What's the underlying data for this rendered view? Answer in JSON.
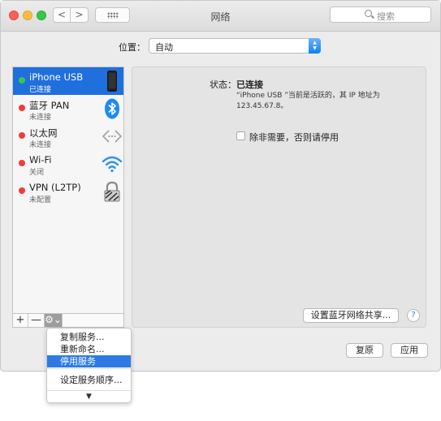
{
  "window": {
    "title": "网络"
  },
  "toolbar": {
    "back_glyph": "<",
    "forward_glyph": ">",
    "grid_icon": "grid-icon"
  },
  "search": {
    "placeholder": "搜索"
  },
  "location": {
    "label": "位置：",
    "value": "自动"
  },
  "services": [
    {
      "name": "iPhone USB",
      "status": "已连接",
      "dot": "green",
      "icon": "iphone-icon",
      "selected": true
    },
    {
      "name": "蓝牙 PAN",
      "status": "未连接",
      "dot": "red",
      "icon": "bluetooth-icon",
      "selected": false
    },
    {
      "name": "以太网",
      "status": "未连接",
      "dot": "red",
      "icon": "ethernet-icon",
      "selected": false
    },
    {
      "name": "Wi-Fi",
      "status": "关闭",
      "dot": "red",
      "icon": "wifi-icon",
      "selected": false
    },
    {
      "name": "VPN (L2TP)",
      "status": "未配置",
      "dot": "red",
      "icon": "vpn-lock-icon",
      "selected": false
    }
  ],
  "sidebar_tools": {
    "add": "+",
    "remove": "—",
    "gear": "⚙⌄"
  },
  "detail": {
    "status_label": "状态：",
    "status_value": "已连接",
    "status_desc_line1": "“iPhone USB ”当前是活跃的，其 IP 地址为",
    "status_desc_line2": "123.45.67.8。",
    "checkbox_label": "除非需要，否则请停用"
  },
  "buttons": {
    "bt_share": "设置蓝牙网络共享...",
    "help": "?",
    "revert": "复原",
    "apply": "应用"
  },
  "menu": {
    "items": [
      "复制服务...",
      "重新命名...",
      "停用服务",
      "设定服务顺序..."
    ],
    "highlighted": "停用服务",
    "more_arrow": "▼"
  },
  "colors": {
    "selection": "#1f6fdd",
    "menu_highlight": "#2d7ae4",
    "status_green": "#34c84a",
    "status_red": "#f23b3b"
  }
}
